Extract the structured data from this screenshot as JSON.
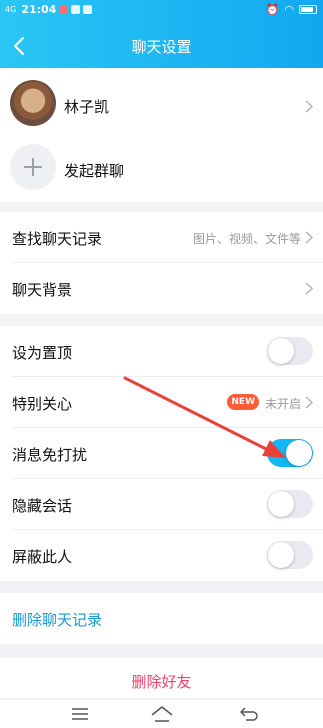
{
  "status": {
    "network": "4G",
    "time": "21:04"
  },
  "header": {
    "title": "聊天设置"
  },
  "profile": {
    "name": "林子凯"
  },
  "group": {
    "label": "发起群聊"
  },
  "section1": {
    "find_label": "查找聊天记录",
    "find_hint": "图片、视频、文件等",
    "background_label": "聊天背景"
  },
  "section2": {
    "pin_label": "设为置顶",
    "special_label": "特别关心",
    "special_badge": "NEW",
    "special_hint": "未开启",
    "mute_label": "消息免打扰",
    "hide_label": "隐藏会话",
    "block_label": "屏蔽此人"
  },
  "toggles": {
    "pin_on": false,
    "mute_on": true,
    "hide_on": false,
    "block_on": false
  },
  "actions": {
    "delete_log": "删除聊天记录",
    "delete_friend": "删除好友"
  },
  "colors": {
    "accent": "#12b7f5",
    "danger": "#e8456a",
    "link": "#1a9ad6",
    "annotation_arrow": "#e8413a"
  }
}
